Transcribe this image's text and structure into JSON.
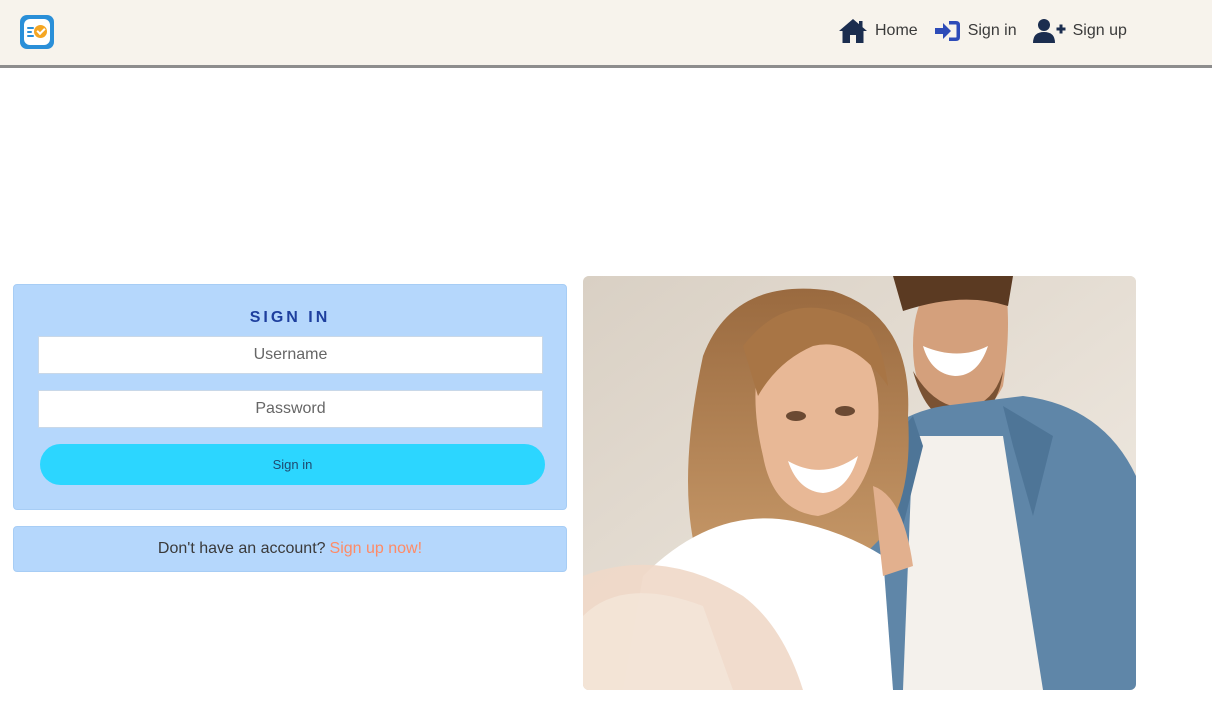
{
  "nav": {
    "items": [
      {
        "label": "Home",
        "icon": "home-icon"
      },
      {
        "label": "Sign in",
        "icon": "sign-in-icon"
      },
      {
        "label": "Sign up",
        "icon": "user-plus-icon"
      }
    ]
  },
  "signin": {
    "title": "SIGN IN",
    "username_placeholder": "Username",
    "password_placeholder": "Password",
    "button_label": "Sign in"
  },
  "signup_prompt": {
    "text": "Don't have an account?",
    "link": "Sign up now!"
  },
  "colors": {
    "navbar_bg": "#f7f3ec",
    "card_bg": "#b5d7fc",
    "button_bg": "#2cd6ff",
    "title_color": "#1e3f9e",
    "link_color": "#ff8a65",
    "nav_icon_dark": "#1b2d4f",
    "nav_icon_blue": "#2d4bb8"
  }
}
